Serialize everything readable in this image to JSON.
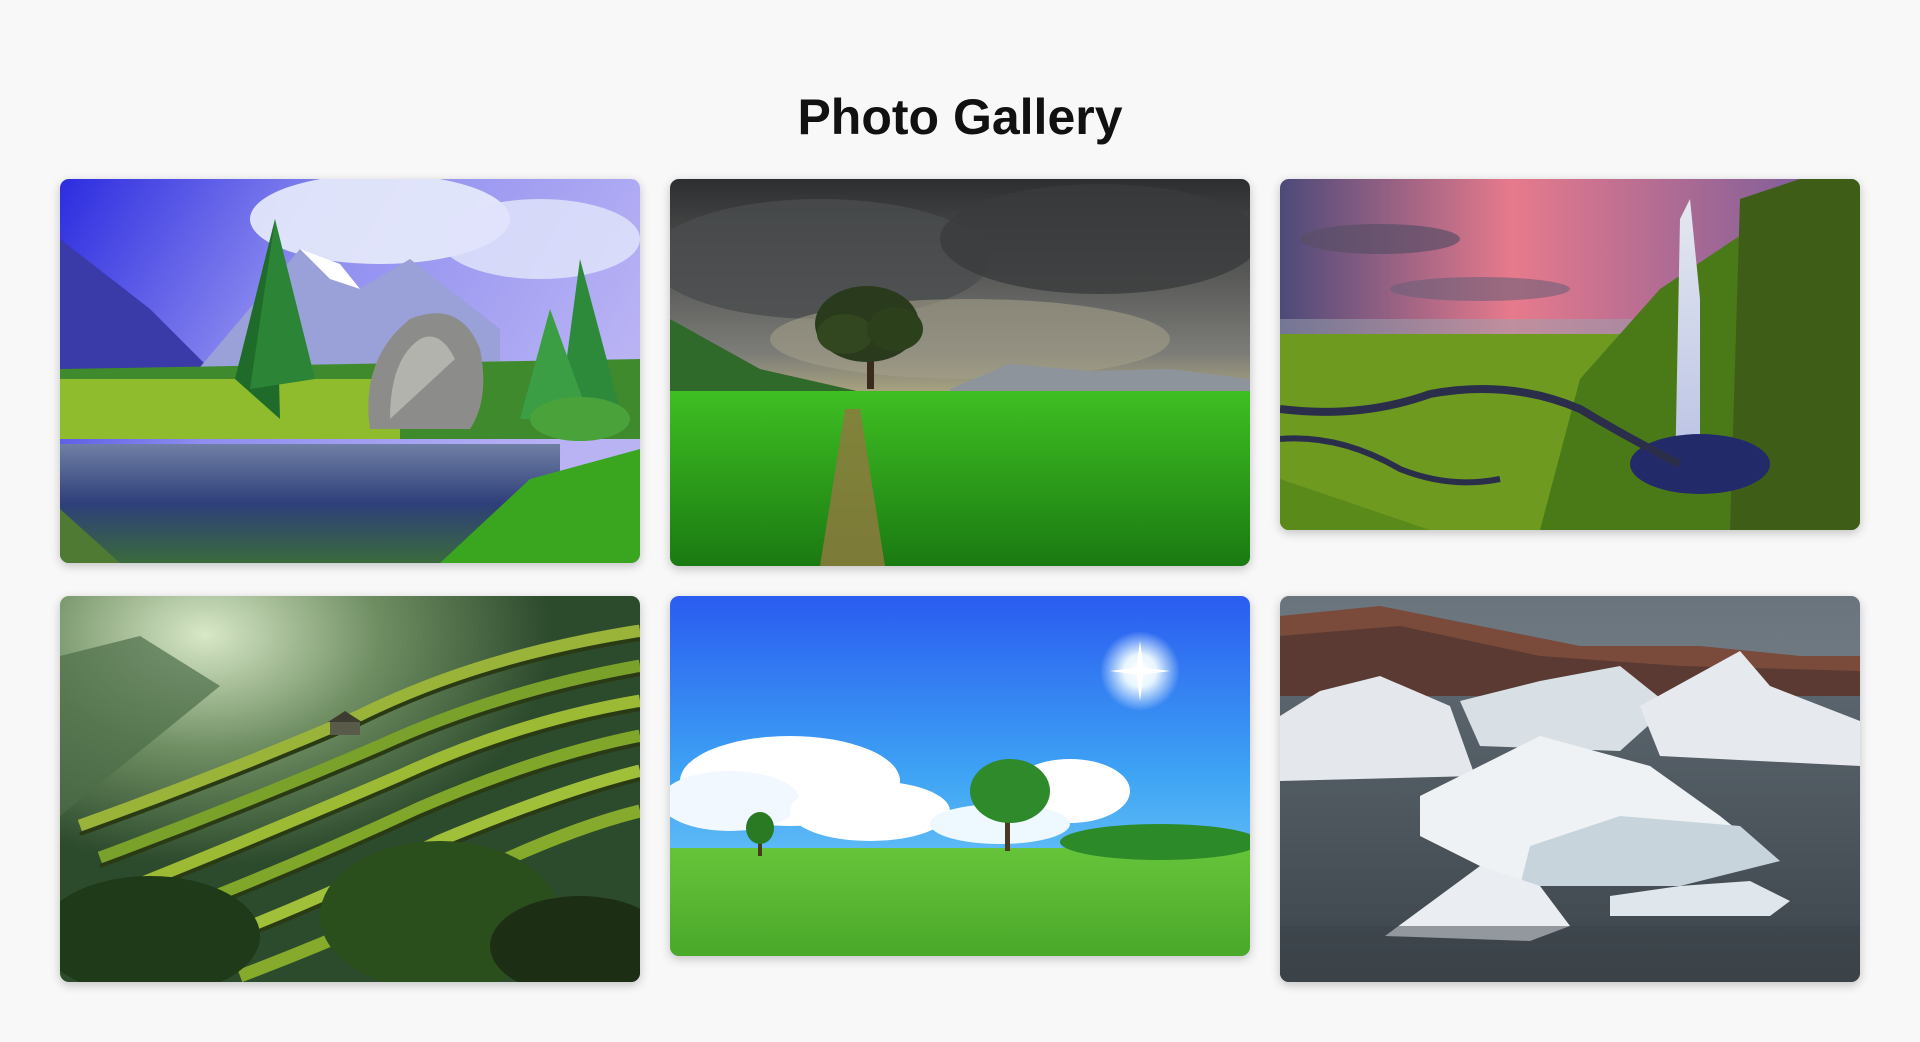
{
  "gallery": {
    "title": "Photo Gallery"
  },
  "photos": [
    {
      "name": "mountain-lake-boulder"
    },
    {
      "name": "lone-tree-green-field"
    },
    {
      "name": "waterfall-valley-sunset"
    },
    {
      "name": "rice-terraces"
    },
    {
      "name": "blue-sky-meadow"
    },
    {
      "name": "icebergs-fjord"
    }
  ]
}
